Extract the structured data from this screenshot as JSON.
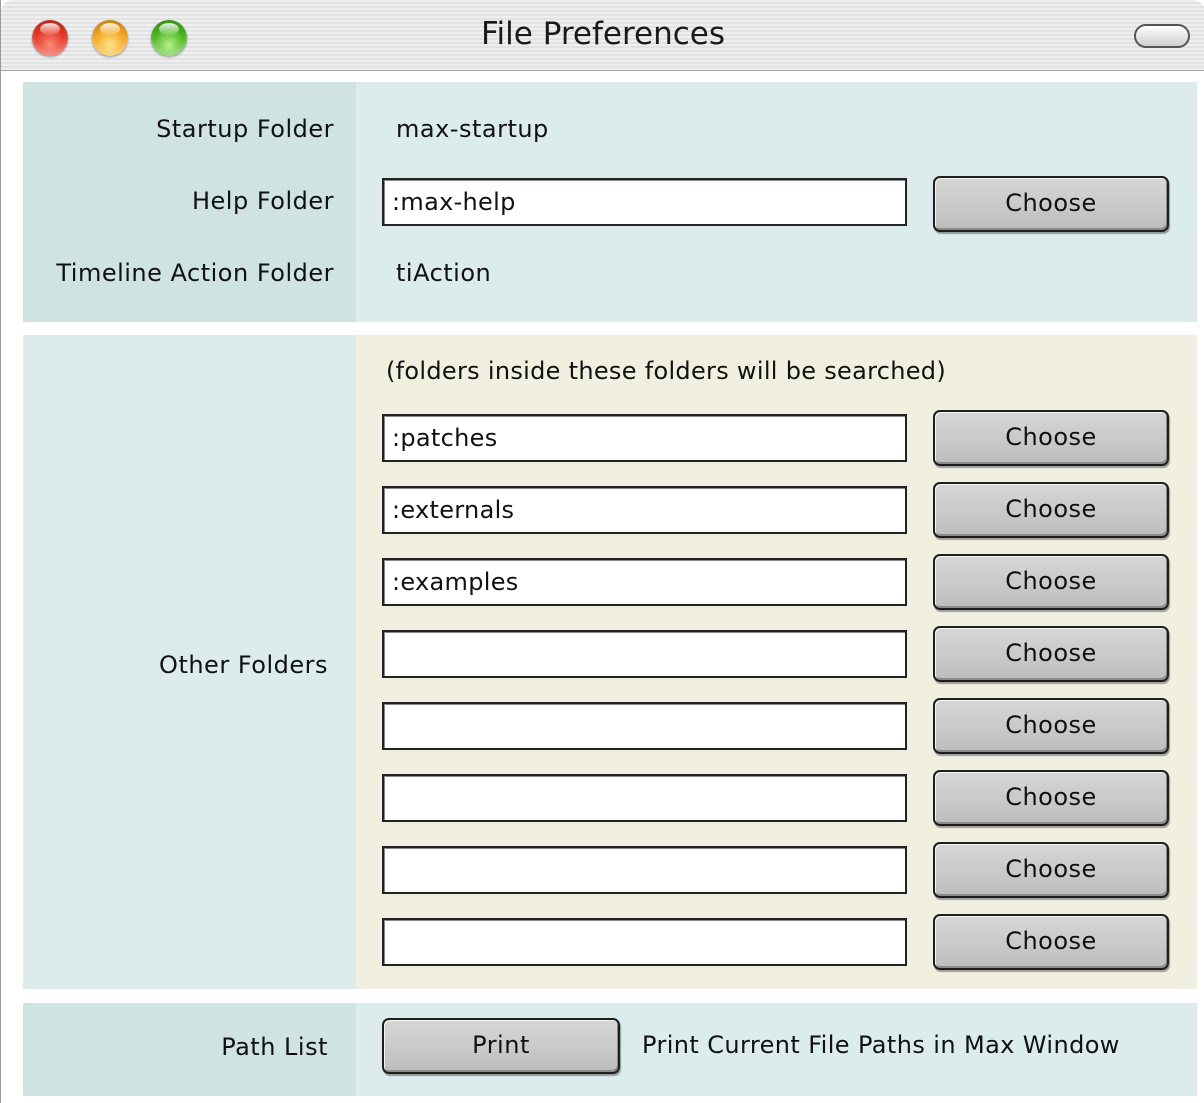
{
  "window": {
    "title": "File Preferences"
  },
  "startup": {
    "label": "Startup Folder",
    "value": "max-startup"
  },
  "help": {
    "label": "Help Folder",
    "value": ":max-help",
    "button": "Choose"
  },
  "timeline": {
    "label": "Timeline Action Folder",
    "value": "tiAction"
  },
  "other": {
    "label": "Other Folders",
    "hint": "(folders inside these folders will be searched)",
    "folders": [
      {
        "value": ":patches",
        "button": "Choose"
      },
      {
        "value": ":externals",
        "button": "Choose"
      },
      {
        "value": ":examples",
        "button": "Choose"
      },
      {
        "value": "",
        "button": "Choose"
      },
      {
        "value": "",
        "button": "Choose"
      },
      {
        "value": "",
        "button": "Choose"
      },
      {
        "value": "",
        "button": "Choose"
      },
      {
        "value": "",
        "button": "Choose"
      }
    ]
  },
  "pathlist": {
    "label": "Path List",
    "button": "Print",
    "description": "Print Current File Paths in Max Window"
  },
  "icons": {
    "close": "close-icon",
    "minimize": "minimize-icon",
    "zoom": "zoom-icon",
    "toolbar_toggle": "toolbar-toggle-icon"
  },
  "colors": {
    "label_column": "#cfe3e3",
    "content_column": "#dcecec",
    "other_folders_content": "#f0efe0"
  }
}
